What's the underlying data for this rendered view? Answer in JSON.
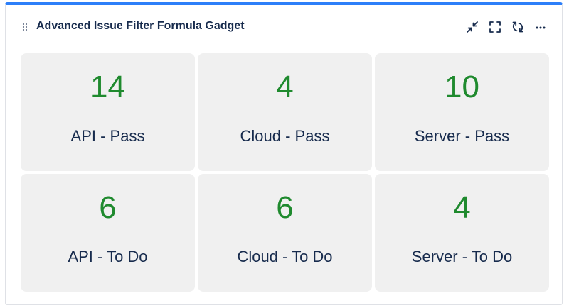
{
  "gadget": {
    "title": "Advanced Issue Filter Formula Gadget",
    "accent_color": "#2d7ff9",
    "value_color": "#1f8a2e",
    "actions": [
      {
        "icon": "minimize-icon"
      },
      {
        "icon": "fullscreen-icon"
      },
      {
        "icon": "refresh-icon"
      },
      {
        "icon": "more-icon"
      }
    ]
  },
  "cards": [
    {
      "value": "14",
      "label": "API - Pass"
    },
    {
      "value": "4",
      "label": "Cloud - Pass"
    },
    {
      "value": "10",
      "label": "Server - Pass"
    },
    {
      "value": "6",
      "label": "API - To Do"
    },
    {
      "value": "6",
      "label": "Cloud - To Do"
    },
    {
      "value": "4",
      "label": "Server - To Do"
    }
  ]
}
